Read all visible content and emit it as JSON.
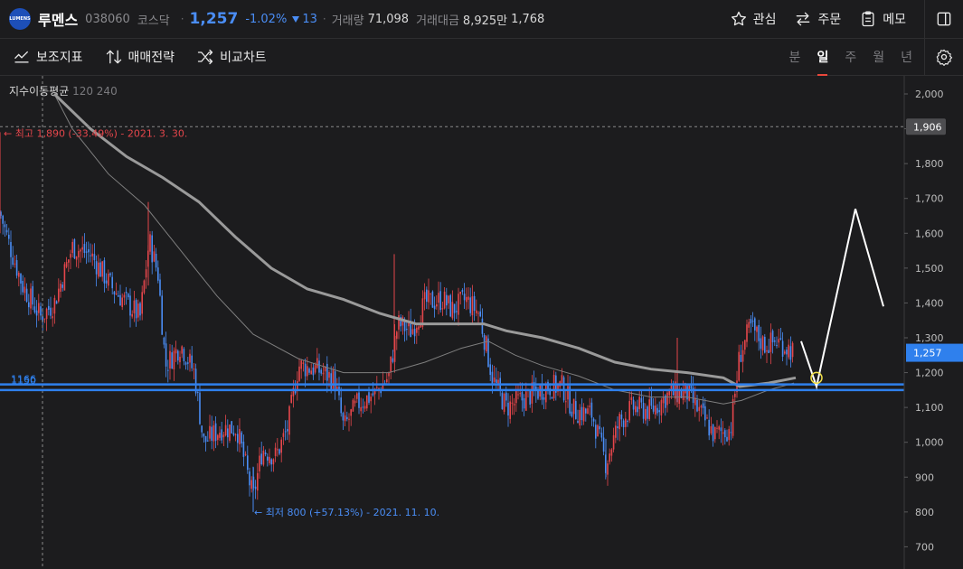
{
  "header": {
    "logo_text": "LUMENS",
    "name": "루멘스",
    "code": "038060",
    "market": "코스닥",
    "price": "1,257",
    "change_pct": "-1.02%",
    "change_amt": "13",
    "volume_label": "거래량",
    "volume": "71,098",
    "amount_label": "거래대금",
    "amount": "8,925만",
    "amount_extra": "1,768",
    "watch_label": "관심",
    "order_label": "주문",
    "memo_label": "메모"
  },
  "toolbar": {
    "indicators": "보조지표",
    "strategy": "매매전략",
    "compare": "비교차트",
    "periods": [
      "분",
      "일",
      "주",
      "월",
      "년"
    ],
    "active_period": "일"
  },
  "legend": {
    "title": "지수이동평균",
    "params": "120 240"
  },
  "chart_data": {
    "type": "candlestick",
    "y_ticks": [
      "2,000",
      "1,900",
      "1,800",
      "1,700",
      "1,600",
      "1,500",
      "1,400",
      "1,300",
      "1,200",
      "1,100",
      "1,000",
      "900",
      "800",
      "700"
    ],
    "ylim": [
      650,
      2050
    ],
    "current_price": "1,257",
    "crosshair_price": "1,906",
    "high_annotation": "← 최고 1,890 (-33.49%) - 2021. 3. 30.",
    "low_annotation": "← 최저 800 (+57.13%) - 2021. 11. 10.",
    "support_lines": [
      {
        "label": "1166",
        "value": 1166
      },
      {
        "label": "1150",
        "value": 1150
      }
    ],
    "colors": {
      "up": "#e5464b",
      "down": "#4a8df5",
      "ma120": "#8c8c8c",
      "ma240": "#9c9c9c",
      "support": "#2f80ed",
      "current": "#2f80ed"
    }
  }
}
